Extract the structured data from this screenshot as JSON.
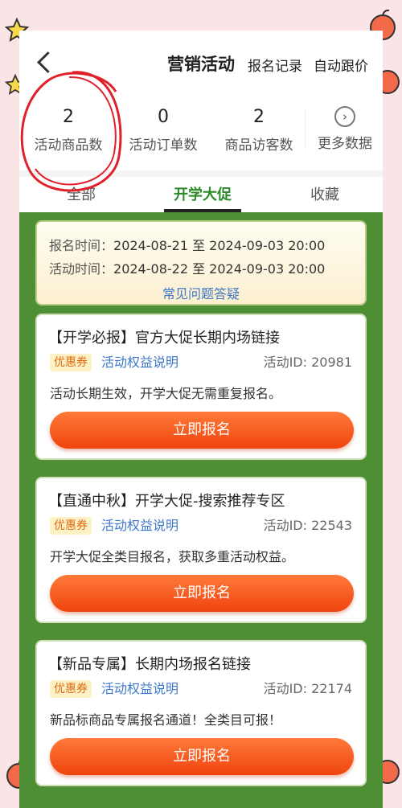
{
  "header": {
    "title": "营销活动",
    "signup_records": "报名记录",
    "auto_price": "自动跟价"
  },
  "stats": [
    {
      "value": "2",
      "label": "活动商品数"
    },
    {
      "value": "0",
      "label": "活动订单数"
    },
    {
      "value": "2",
      "label": "商品访客数"
    }
  ],
  "more_data": {
    "label": "更多数据",
    "icon": "chevron-right-circle-icon"
  },
  "tabs": [
    {
      "label": "全部",
      "active": false
    },
    {
      "label": "开学大促",
      "active": true
    },
    {
      "label": "收藏",
      "active": false
    }
  ],
  "info": {
    "signup_label": "报名时间：",
    "signup_value": "2024-08-21 至 2024-09-03 20:00",
    "activity_label": "活动时间：",
    "activity_value": "2024-08-22 至 2024-09-03 20:00",
    "faq": "常见问题答疑"
  },
  "cards": [
    {
      "title": "【开学必报】官方大促长期内场链接",
      "coupon": "优惠券",
      "rights": "活动权益说明",
      "activity_id": "活动ID: 20981",
      "desc": "活动长期生效，开学大促无需重复报名。",
      "button": "立即报名"
    },
    {
      "title": "【直通中秋】开学大促-搜索推荐专区",
      "coupon": "优惠券",
      "rights": "活动权益说明",
      "activity_id": "活动ID: 22543",
      "desc": "开学大促全类目报名，获取多重活动权益。",
      "button": "立即报名"
    },
    {
      "title": "【新品专属】长期内场报名链接",
      "coupon": "优惠券",
      "rights": "活动权益说明",
      "activity_id": "活动ID: 22174",
      "desc": "新品标商品专属报名通道！全类目可报！",
      "button": "立即报名"
    }
  ],
  "colors": {
    "accent_green": "#4e8f35",
    "button_orange": "#f0440e",
    "link_blue": "#3f78c8",
    "annotation_red": "#e0202a"
  }
}
